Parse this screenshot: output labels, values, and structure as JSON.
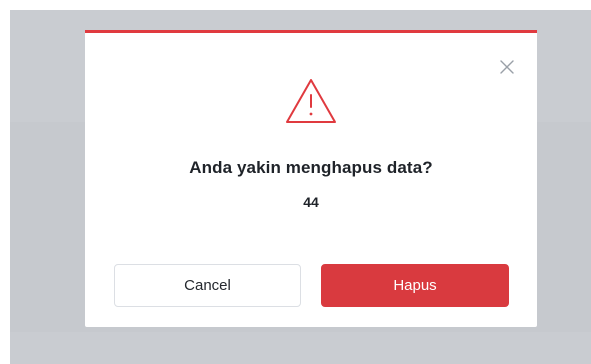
{
  "dialog": {
    "title": "Anda yakin menghapus data?",
    "subtitle": "44",
    "cancel_label": "Cancel",
    "confirm_label": "Hapus",
    "icons": {
      "close": "close-icon",
      "warning": "warning-triangle-icon"
    },
    "colors": {
      "accent": "#d93a3f",
      "overlay": "#c9ccd1",
      "text": "#1f2329"
    }
  }
}
